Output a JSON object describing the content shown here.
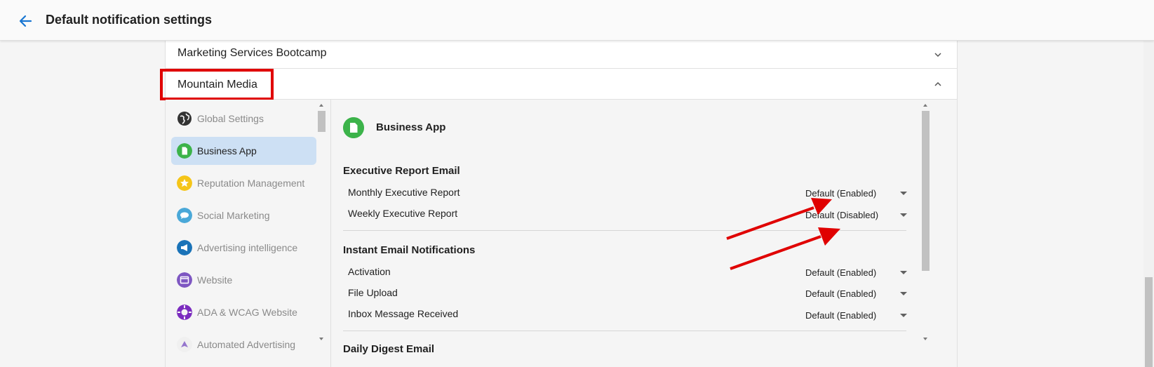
{
  "header": {
    "title": "Default notification settings"
  },
  "accordions": [
    {
      "title": "Marketing Services Bootcamp",
      "expanded": false
    },
    {
      "title": "Mountain Media",
      "expanded": true
    }
  ],
  "nav": {
    "items": [
      {
        "label": "Global Settings",
        "icon": "globe-icon",
        "color": "#333333",
        "active": false
      },
      {
        "label": "Business App",
        "icon": "document-icon",
        "color": "#3cb34a",
        "active": true
      },
      {
        "label": "Reputation Management",
        "icon": "star-icon",
        "color": "#f5c518",
        "active": false
      },
      {
        "label": "Social Marketing",
        "icon": "chat-bubble-icon",
        "color": "#4aa8d8",
        "active": false
      },
      {
        "label": "Advertising intelligence",
        "icon": "megaphone-icon",
        "color": "#1a73b8",
        "active": false
      },
      {
        "label": "Website",
        "icon": "browser-window-icon",
        "color": "#7e57c2",
        "active": false
      },
      {
        "label": "ADA & WCAG Website",
        "icon": "accessibility-icon",
        "color": "#7b2cbf",
        "active": false
      },
      {
        "label": "Automated Advertising",
        "icon": "rocket-icon",
        "color": "#9575cd",
        "active": false
      }
    ]
  },
  "main": {
    "app_title": "Business App",
    "sections": [
      {
        "title": "Executive Report Email",
        "rows": [
          {
            "label": "Monthly Executive Report",
            "value": "Default (Enabled)"
          },
          {
            "label": "Weekly Executive Report",
            "value": "Default (Disabled)"
          }
        ]
      },
      {
        "title": "Instant Email Notifications",
        "rows": [
          {
            "label": "Activation",
            "value": "Default (Enabled)"
          },
          {
            "label": "File Upload",
            "value": "Default (Enabled)"
          },
          {
            "label": "Inbox Message Received",
            "value": "Default (Enabled)"
          }
        ]
      },
      {
        "title": "Daily Digest Email",
        "rows": []
      }
    ]
  },
  "colors": {
    "accent": "#1976d2",
    "annotation": "#e00000",
    "active_nav": "#cde0f4"
  }
}
